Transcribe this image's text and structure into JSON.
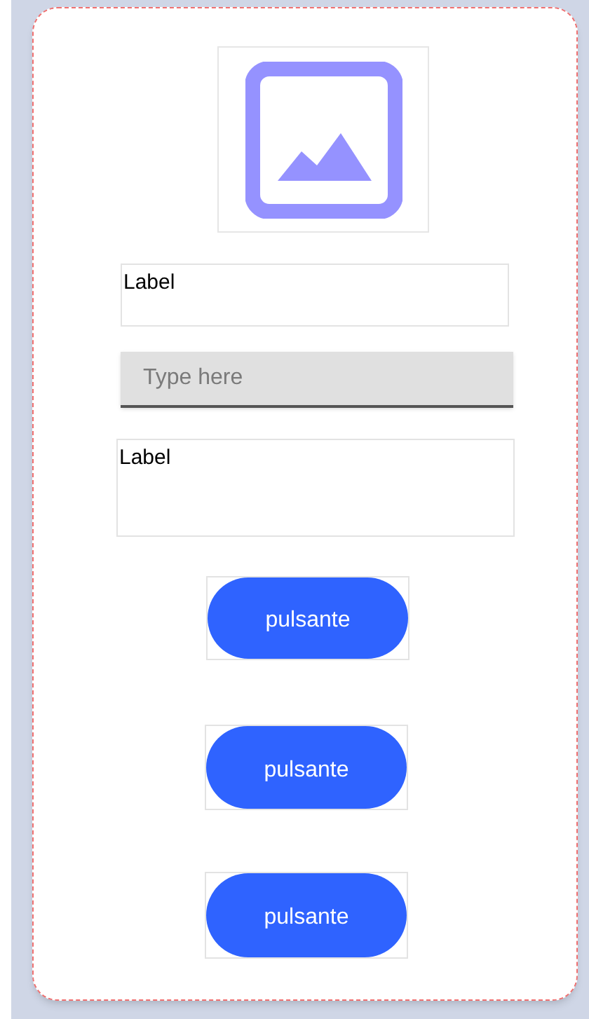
{
  "fields": [
    {
      "kind": "label",
      "text": "Label"
    },
    {
      "kind": "input",
      "placeholder": "Type here"
    },
    {
      "kind": "label",
      "text": "Label"
    }
  ],
  "buttons": [
    {
      "label": "pulsante"
    },
    {
      "label": "pulsante"
    },
    {
      "label": "pulsante"
    }
  ]
}
